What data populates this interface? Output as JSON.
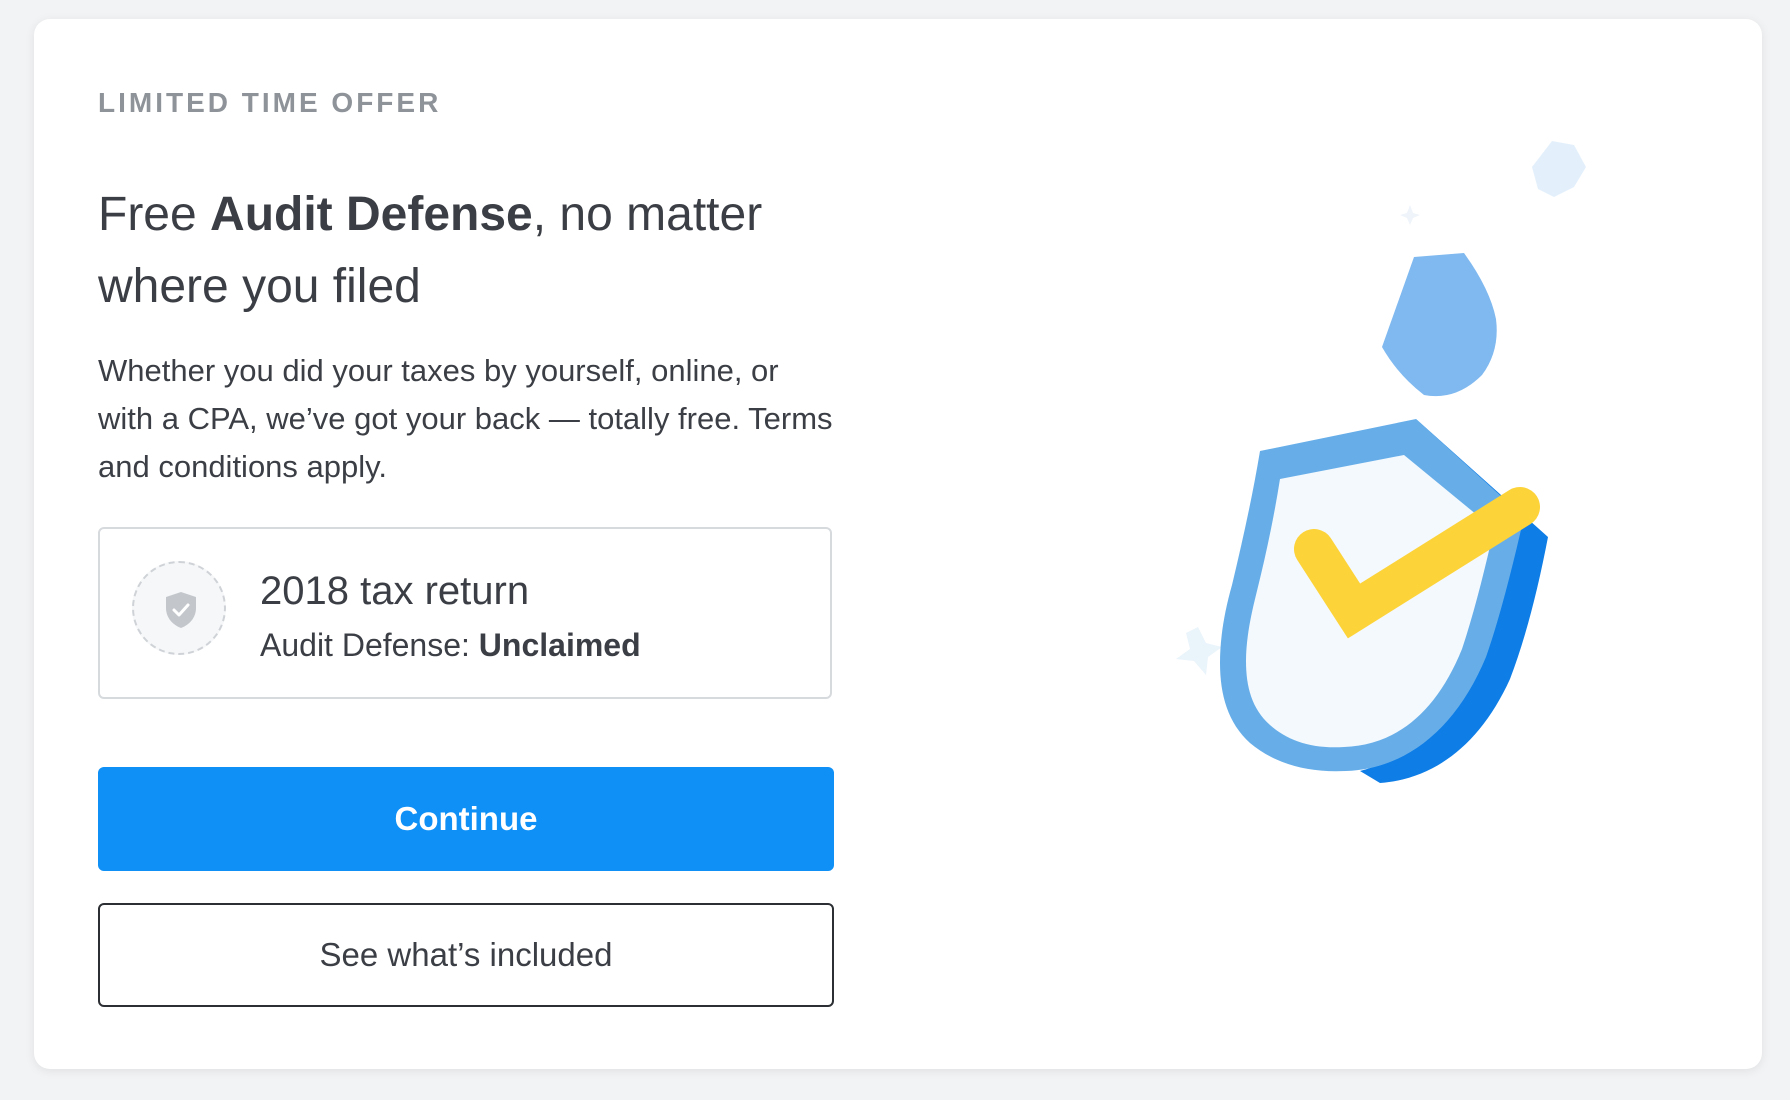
{
  "offer": {
    "eyebrow": "LIMITED TIME OFFER",
    "headline_pre": "Free ",
    "headline_bold": "Audit Defense",
    "headline_post": ", no matter where you filed",
    "description": "Whether you did your taxes by yourself, online, or with a CPA, we’ve got your back — totally free. Terms and conditions apply."
  },
  "status": {
    "title": "2018 tax return",
    "label": "Audit Defense: ",
    "value": "Unclaimed",
    "icon": "shield-check-icon"
  },
  "actions": {
    "continue_label": "Continue",
    "included_label": "See what’s included"
  },
  "illustration": {
    "icon": "shield-checkmark-illustration"
  },
  "colors": {
    "primary": "#0e90f6",
    "shield_light": "#67aee9",
    "shield_dark": "#0e7de6",
    "check": "#fdd33a",
    "text": "#3b3f45",
    "muted": "#8e9399"
  }
}
